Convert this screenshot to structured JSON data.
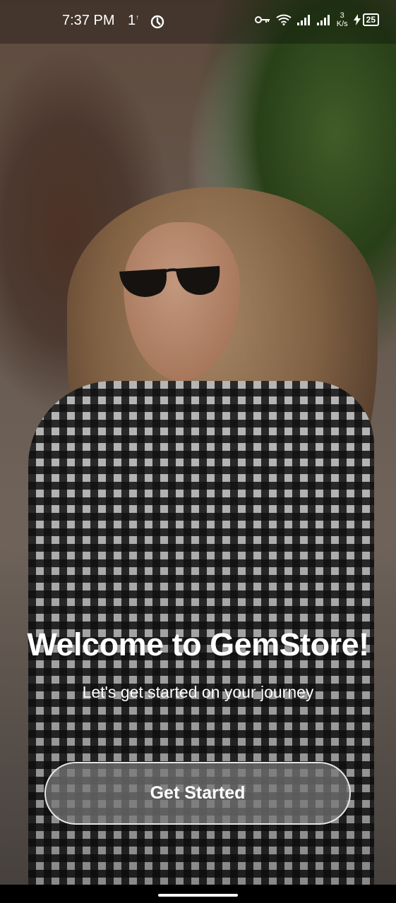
{
  "status_bar": {
    "time": "7:37 PM",
    "notification_1": "1",
    "network_speed_value": "3",
    "network_speed_unit": "K/s",
    "battery_level": "25",
    "icons": [
      "key-icon",
      "wifi-icon",
      "signal-icon",
      "signal-icon",
      "charging-icon",
      "battery-icon",
      "sync-icon"
    ]
  },
  "welcome": {
    "title": "Welcome to GemStore!",
    "subtitle": "Let's get started on your journey"
  },
  "cta": {
    "label": "Get Started"
  }
}
